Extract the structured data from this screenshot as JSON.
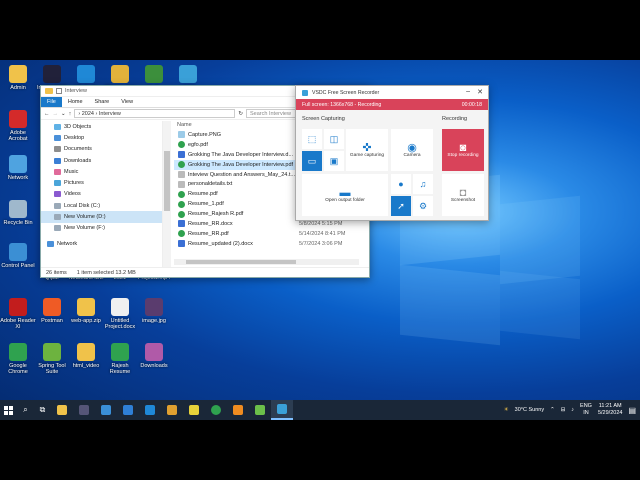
{
  "desktop": {
    "icons": [
      {
        "label": "Admin",
        "icon": "user-folder-icon",
        "color": "#f0c24a"
      },
      {
        "label": "Adobe Acrobat",
        "icon": "acrobat-icon",
        "color": "#d42a2a"
      },
      {
        "label": "Network",
        "icon": "network-icon",
        "color": "#4fa3e0"
      },
      {
        "label": "Recycle Bin",
        "icon": "recycle-bin-icon",
        "color": "#9fb8cc"
      },
      {
        "label": "Control Panel",
        "icon": "control-panel-icon",
        "color": "#3b8fd4"
      },
      {
        "label": "Adobe Reader XI",
        "icon": "reader-icon",
        "color": "#c21d1d"
      },
      {
        "label": "Google Chrome",
        "icon": "chrome-icon",
        "color": "#2fa24f"
      },
      {
        "label": "Q.pdf",
        "icon": "pdf-file-icon",
        "color": "#e9e9e9"
      },
      {
        "label": "NetBeans IDE",
        "icon": "netbeans-icon",
        "color": "#1f6fb8"
      },
      {
        "label": "2021",
        "icon": "folder-icon",
        "color": "#f0c24a"
      },
      {
        "label": "Project1.mp4",
        "icon": "video-file-icon",
        "color": "#333333"
      },
      {
        "label": "Postman",
        "icon": "postman-icon",
        "color": "#ef5b25"
      },
      {
        "label": "web-app.zip",
        "icon": "zip-file-icon",
        "color": "#f0c24a"
      },
      {
        "label": "Untitled Project.docx",
        "icon": "docx-file-icon",
        "color": "#f0f0f0"
      },
      {
        "label": "image.jpg",
        "icon": "image-file-icon",
        "color": "#5a3c6e"
      },
      {
        "label": "Spring Tool Suite",
        "icon": "spring-icon",
        "color": "#6db33f"
      },
      {
        "label": "html_video",
        "icon": "folder-icon",
        "color": "#f0c24a"
      },
      {
        "label": "Rajesh Resume",
        "icon": "chrome-icon",
        "color": "#2fa24f"
      },
      {
        "label": "Downloads",
        "icon": "downloads-icon",
        "color": "#b05aa8"
      },
      {
        "label": "IntelliJ IDEA",
        "icon": "intellij-icon",
        "color": "#21213a"
      },
      {
        "label": "VS Code",
        "icon": "vscode-icon",
        "color": "#1f88d6"
      },
      {
        "label": "Chrome App",
        "icon": "chrome-icon",
        "color": "#e2b23b"
      },
      {
        "label": "Media",
        "icon": "media-icon",
        "color": "#3c8f3c"
      },
      {
        "label": "VSDC",
        "icon": "vsdc-icon",
        "color": "#3aa0d8"
      }
    ]
  },
  "explorer": {
    "title": "Interview",
    "ribbon_tabs": [
      "File",
      "Home",
      "Share",
      "View"
    ],
    "breadcrumb": "›  2024  ›  Interview",
    "search_placeholder": "Search Interview",
    "nav_items": [
      {
        "label": "3D Objects",
        "color": "#5fb2e6"
      },
      {
        "label": "Desktop",
        "color": "#4a90d9"
      },
      {
        "label": "Documents",
        "color": "#8e8e8e"
      },
      {
        "label": "Downloads",
        "color": "#3a7fd5"
      },
      {
        "label": "Music",
        "color": "#e06a9a"
      },
      {
        "label": "Pictures",
        "color": "#4aa5d9"
      },
      {
        "label": "Videos",
        "color": "#8a5ad0"
      },
      {
        "label": "Local Disk (C:)",
        "color": "#9aa9b8"
      },
      {
        "label": "New Volume (D:)",
        "color": "#9aa9b8"
      },
      {
        "label": "New Volume (F:)",
        "color": "#9aa9b8"
      },
      {
        "label": "Network",
        "color": "#4a90d9"
      }
    ],
    "column_name": "Name",
    "files": [
      {
        "name": "Capture.PNG",
        "date": "",
        "icon": "png",
        "color": "#9ccbe8"
      },
      {
        "name": "egfo.pdf",
        "date": "",
        "icon": "chrome",
        "color": "#2fa24f"
      },
      {
        "name": "Grokking The Java Developer Interview.d...",
        "date": "",
        "icon": "docx",
        "color": "#3b6fd4"
      },
      {
        "name": "Grokking The Java Developer Interview.pdf",
        "date": "",
        "icon": "chrome",
        "color": "#2fa24f"
      },
      {
        "name": "Inteview Question and Answers_May_24.t...",
        "date": "",
        "icon": "txt",
        "color": "#bbbbbb"
      },
      {
        "name": "personaldetails.txt",
        "date": "",
        "icon": "txt",
        "color": "#bbbbbb"
      },
      {
        "name": "Resume.pdf",
        "date": "",
        "icon": "chrome",
        "color": "#2fa24f"
      },
      {
        "name": "Resume_1.pdf",
        "date": "",
        "icon": "chrome",
        "color": "#2fa24f"
      },
      {
        "name": "Resume_Rajesh R.pdf",
        "date": "5/25/2024 9:48 AM",
        "icon": "chrome",
        "color": "#2fa24f"
      },
      {
        "name": "Resume_RR.docx",
        "date": "5/8/2024 5:15 PM",
        "icon": "docx",
        "color": "#3b6fd4"
      },
      {
        "name": "Resume_RR.pdf",
        "date": "5/14/2024 8:41 PM",
        "icon": "chrome",
        "color": "#2fa24f"
      },
      {
        "name": "Resume_updated (2).docx",
        "date": "5/7/2024 3:06 PM",
        "icon": "docx",
        "color": "#3b6fd4"
      }
    ],
    "status_count": "26 items",
    "status_selected": "1 item selected  13.2 MB"
  },
  "vsdc": {
    "title": "VSDC Free Screen Recorder",
    "status_text": "Full screen: 1366x768 - Recording",
    "timer": "00:00:18",
    "section_capturing": "Screen Capturing",
    "section_recording": "Recording",
    "game_capturing": "Game capturing",
    "camera": "Camera",
    "stop_recording": "Stop recording",
    "open_output": "Open output folder",
    "screenshot": "Screenshot"
  },
  "taskbar": {
    "weather": "30°C  Sunny",
    "language": "ENG",
    "region": "IN",
    "time": "11:21 AM",
    "date": "5/29/2024",
    "apps": [
      {
        "name": "explorer",
        "color": "#f0c24a"
      },
      {
        "name": "obs",
        "color": "#555577"
      },
      {
        "name": "sticky",
        "color": "#3a8fd8"
      },
      {
        "name": "store",
        "color": "#2f7fd6"
      },
      {
        "name": "mail",
        "color": "#1f88d6"
      },
      {
        "name": "files",
        "color": "#e0a030"
      },
      {
        "name": "pdf",
        "color": "#e8d23a"
      },
      {
        "name": "chrome",
        "color": "#2fa24f"
      },
      {
        "name": "sublime",
        "color": "#f08c20"
      },
      {
        "name": "notepad",
        "color": "#6cc04a"
      },
      {
        "name": "vsdc",
        "color": "#3aa0d8"
      }
    ]
  }
}
